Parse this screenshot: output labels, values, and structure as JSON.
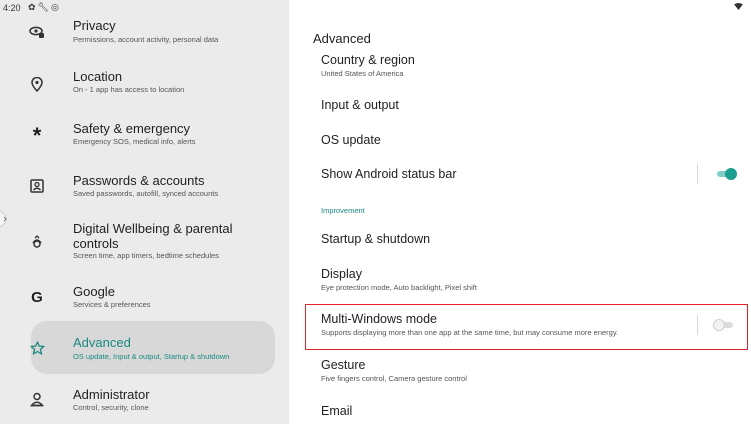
{
  "status_bar": {
    "time": "4:20",
    "icons": [
      "settings-icon",
      "wrench-icon",
      "android-icon",
      "wifi-icon"
    ]
  },
  "sidebar": {
    "items": [
      {
        "title": "Privacy",
        "subtitle": "Permissions, account activity, personal data",
        "icon": "privacy-icon"
      },
      {
        "title": "Location",
        "subtitle": "On - 1 app has access to location",
        "icon": "location-pin-icon"
      },
      {
        "title": "Safety & emergency",
        "subtitle": "Emergency SOS, medical info, alerts",
        "icon": "asterisk-icon"
      },
      {
        "title": "Passwords & accounts",
        "subtitle": "Saved passwords, autofill, synced accounts",
        "icon": "account-box-icon"
      },
      {
        "title": "Digital Wellbeing & parental",
        "title_line2": "controls",
        "subtitle": "Screen time, app timers, bedtime schedules",
        "icon": "wellbeing-icon"
      },
      {
        "title": "Google",
        "subtitle": "Services & preferences",
        "icon": "google-icon"
      },
      {
        "title": "Advanced",
        "subtitle": "OS update, Input & output, Startup & shutdown",
        "icon": "advanced-star-icon",
        "active": true
      },
      {
        "title": "Administrator",
        "subtitle": "Control, security, clone",
        "icon": "administrator-icon"
      }
    ]
  },
  "main": {
    "title": "Advanced",
    "settings": {
      "country": {
        "title": "Country & region",
        "subtitle": "United States of America"
      },
      "input_output": {
        "title": "Input & output"
      },
      "os_update": {
        "title": "OS update"
      },
      "status_bar": {
        "title": "Show Android status bar",
        "enabled": true
      },
      "section_improvement": "Improvement",
      "startup": {
        "title": "Startup & shutdown"
      },
      "display": {
        "title": "Display",
        "subtitle": "Eye protection mode, Auto backlight, Pixel shift"
      },
      "multi_windows": {
        "title": "Multi-Windows mode",
        "subtitle": "Supports displaying more than one app at the same time, but may consume more energy.",
        "enabled": false
      },
      "gesture": {
        "title": "Gesture",
        "subtitle": "Five fingers control, Camera gesture control"
      },
      "email": {
        "title": "Email"
      }
    }
  },
  "colors": {
    "accent": "#1a8a80",
    "sidebar_bg": "#ebebeb",
    "active_item_bg": "#d8d8d8",
    "highlight": "#e0262b"
  }
}
